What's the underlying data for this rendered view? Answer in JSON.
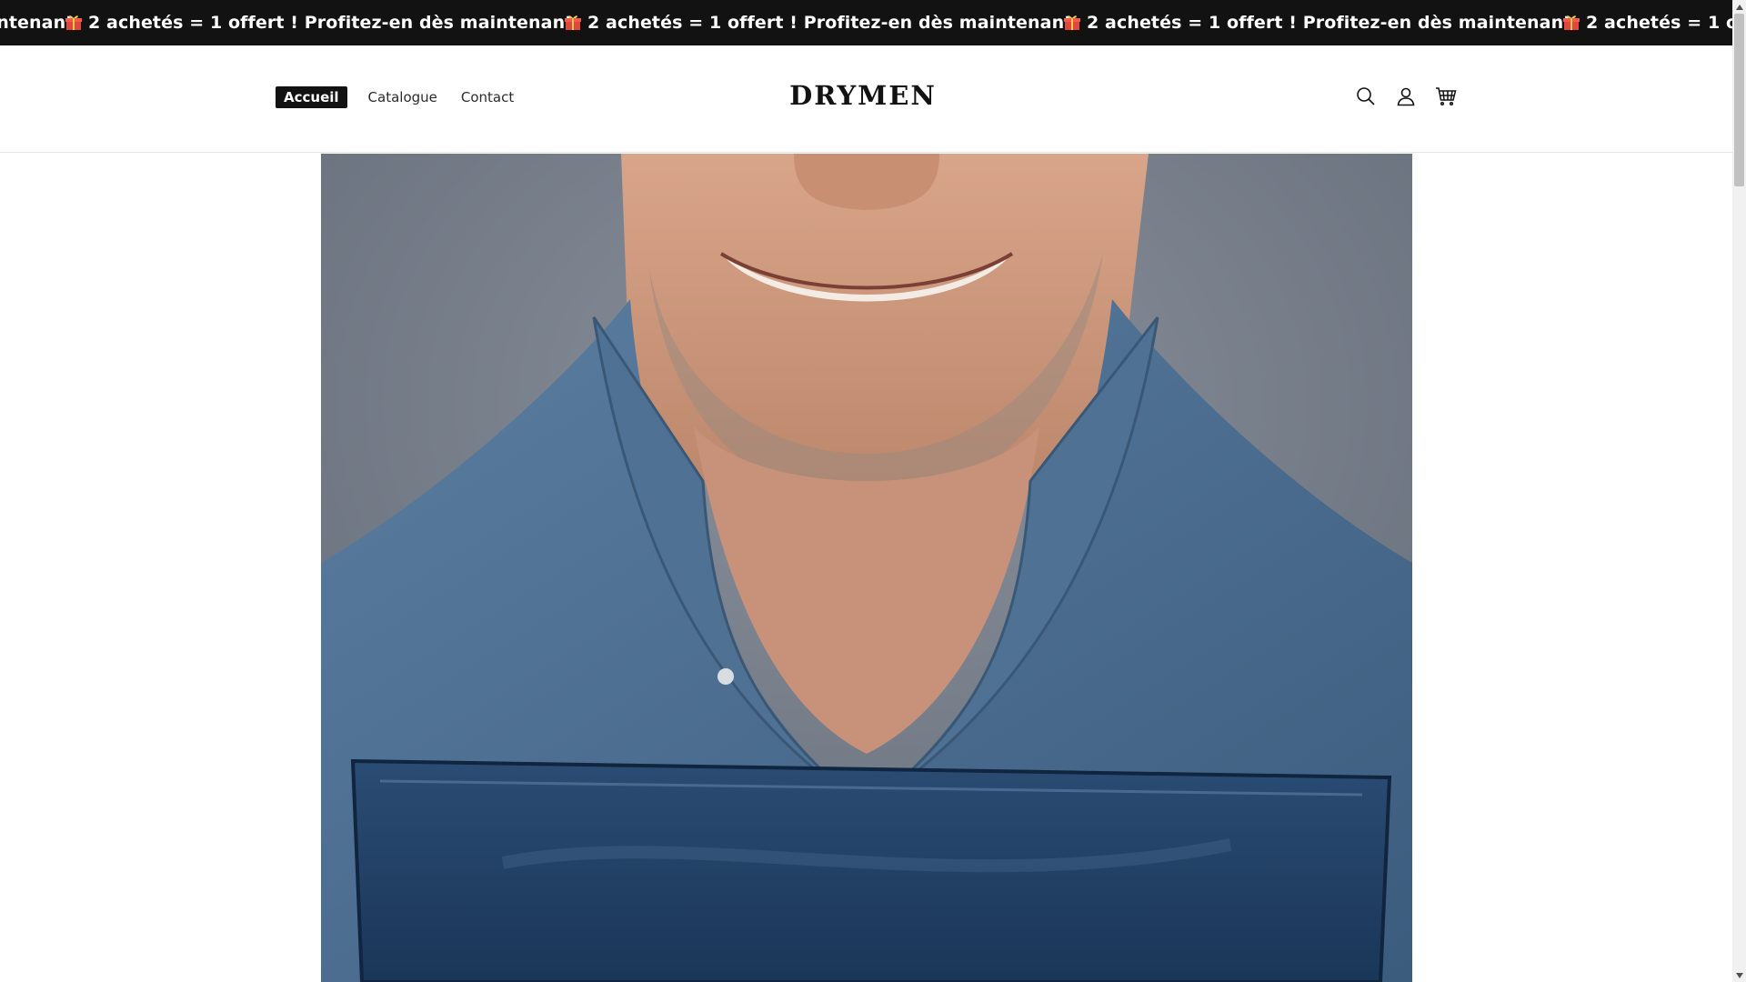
{
  "announcement": {
    "text": "2 achetés = 1 offert ! Profitez-en dès maintenant.",
    "icon": "gift-icon",
    "repeat": 5
  },
  "header": {
    "nav": [
      {
        "label": "Accueil",
        "active": true
      },
      {
        "label": "Catalogue",
        "active": false
      },
      {
        "label": "Contact",
        "active": false
      }
    ],
    "logo": "DRYMEN",
    "icons": [
      "search-icon",
      "account-icon",
      "cart-icon"
    ]
  },
  "hero": {
    "image": "product-hero-image"
  },
  "colors": {
    "announcement_bg": "#121212",
    "text_dark": "#121212",
    "white": "#ffffff",
    "hero_backdrop": "#6f7784",
    "shirt": "#4a6b8c",
    "product_pouch": "#1f3f66"
  }
}
